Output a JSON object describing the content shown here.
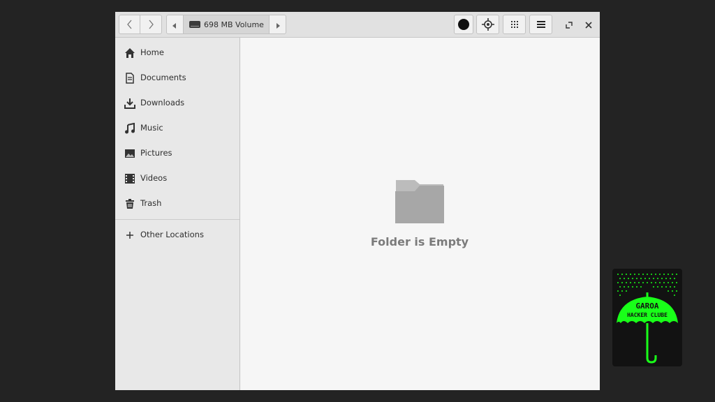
{
  "window": {
    "pathbar": {
      "volume_label": "698 MB Volume",
      "volume_icon": "drive-icon"
    },
    "toolbar": {
      "back_icon": "chevron-left-icon",
      "forward_icon": "chevron-right-icon",
      "record_icon": "record-icon",
      "locate_icon": "crosshair-icon",
      "view_icon": "grid-view-icon",
      "menu_icon": "hamburger-menu-icon"
    },
    "sidebar": {
      "items": [
        {
          "label": "Home",
          "icon": "home-icon"
        },
        {
          "label": "Documents",
          "icon": "document-icon"
        },
        {
          "label": "Downloads",
          "icon": "download-icon"
        },
        {
          "label": "Music",
          "icon": "music-icon"
        },
        {
          "label": "Pictures",
          "icon": "picture-icon"
        },
        {
          "label": "Videos",
          "icon": "video-icon"
        },
        {
          "label": "Trash",
          "icon": "trash-icon"
        }
      ],
      "other_locations": {
        "label": "Other Locations",
        "icon": "plus-icon"
      }
    },
    "main": {
      "empty_message": "Folder is Empty",
      "empty_icon": "folder-icon"
    }
  },
  "desktop": {
    "logo_text_line1": "GAROA",
    "logo_text_line2": "HACKER CLUBE",
    "logo_color": "#19ff19"
  }
}
